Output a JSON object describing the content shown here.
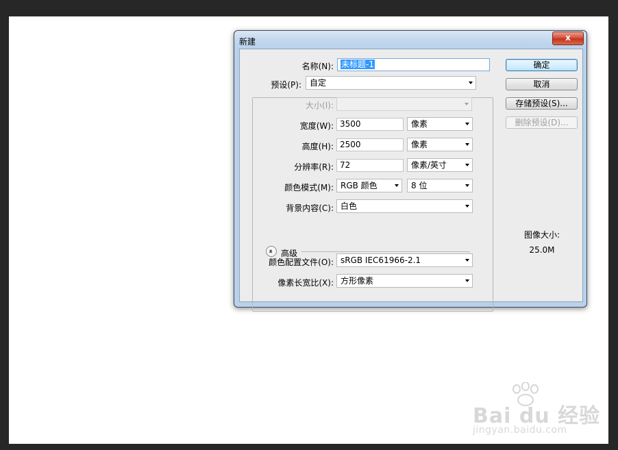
{
  "dialog": {
    "title": "新建",
    "close_label": "x"
  },
  "form": {
    "name_label": "名称(N):",
    "name_value": "未标题-1",
    "preset_label": "预设(P):",
    "preset_value": "自定",
    "size_label": "大小(I):",
    "size_value": "",
    "width_label": "宽度(W):",
    "width_value": "3500",
    "width_unit": "像素",
    "height_label": "高度(H):",
    "height_value": "2500",
    "height_unit": "像素",
    "resolution_label": "分辨率(R):",
    "resolution_value": "72",
    "resolution_unit": "像素/英寸",
    "color_mode_label": "颜色模式(M):",
    "color_mode_value": "RGB 颜色",
    "bit_depth_value": "8 位",
    "background_label": "背景内容(C):",
    "background_value": "白色",
    "advanced_label": "高级",
    "advanced_toggle_icon": "»",
    "color_profile_label": "颜色配置文件(O):",
    "color_profile_value": "sRGB IEC61966-2.1",
    "pixel_aspect_label": "像素长宽比(X):",
    "pixel_aspect_value": "方形像素"
  },
  "buttons": {
    "ok": "确定",
    "cancel": "取消",
    "save_preset": "存储预设(S)...",
    "delete_preset": "删除预设(D)..."
  },
  "info": {
    "image_size_label": "图像大小:",
    "image_size_value": "25.0M"
  },
  "watermark": {
    "brand": "Bai du 经验",
    "url": "jingyan.baidu.com"
  },
  "colors": {
    "selection": "#3399ff",
    "frame": "#b9d1ea",
    "client": "#ececec"
  }
}
